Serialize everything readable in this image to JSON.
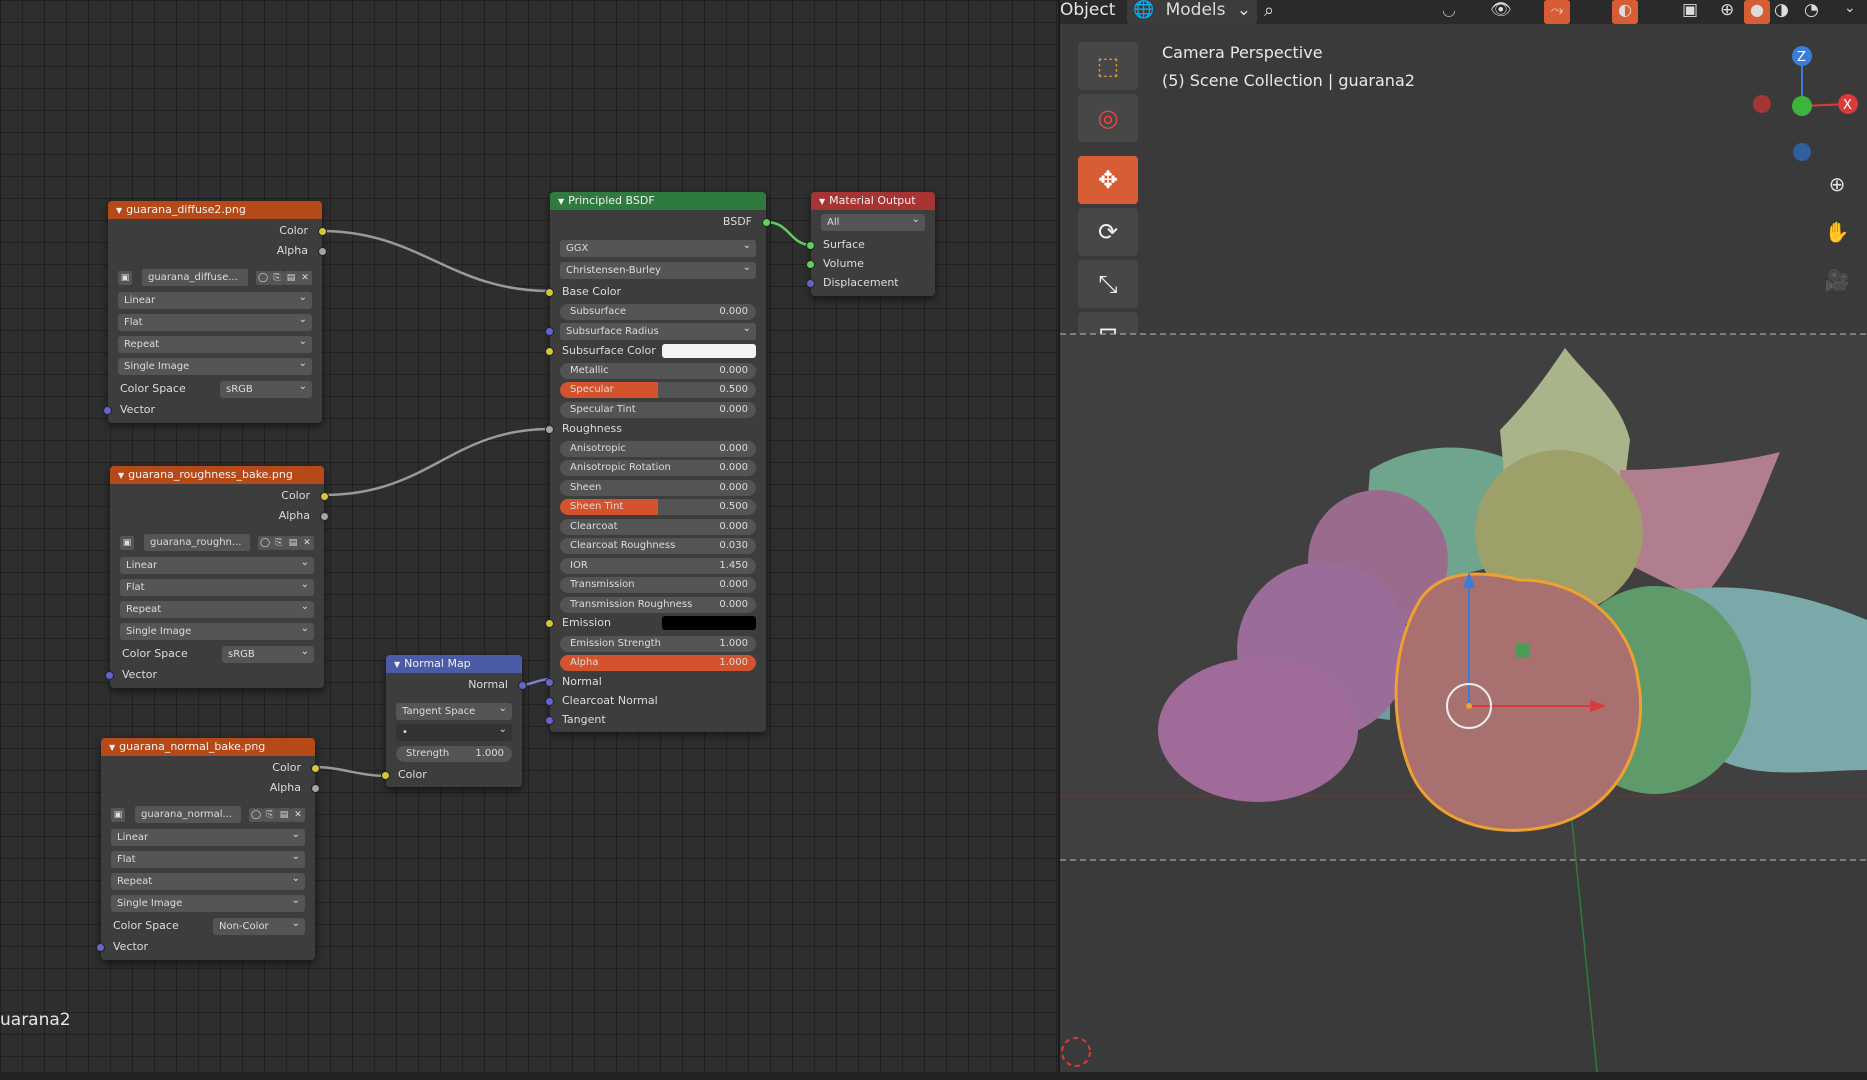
{
  "colors": {
    "accent": "#d65d34",
    "texture_header": "#b54a18",
    "shader_header": "#2f7a3d",
    "output_header": "#a73333",
    "vector_header": "#4c5ba8",
    "selection_outline": "#f0a030"
  },
  "node_editor": {
    "material_name": "uarana2",
    "nodes": {
      "tex1": {
        "title": "guarana_diffuse2.png",
        "out_color": "Color",
        "out_alpha": "Alpha",
        "image_name": "guarana_diffuse...",
        "interpolation": "Linear",
        "projection": "Flat",
        "extension": "Repeat",
        "source": "Single Image",
        "colorspace_label": "Color Space",
        "colorspace": "sRGB",
        "in_vector": "Vector"
      },
      "tex2": {
        "title": "guarana_roughness_bake.png",
        "out_color": "Color",
        "out_alpha": "Alpha",
        "image_name": "guarana_roughn...",
        "interpolation": "Linear",
        "projection": "Flat",
        "extension": "Repeat",
        "source": "Single Image",
        "colorspace_label": "Color Space",
        "colorspace": "sRGB",
        "in_vector": "Vector"
      },
      "tex3": {
        "title": "guarana_normal_bake.png",
        "out_color": "Color",
        "out_alpha": "Alpha",
        "image_name": "guarana_normal...",
        "interpolation": "Linear",
        "projection": "Flat",
        "extension": "Repeat",
        "source": "Single Image",
        "colorspace_label": "Color Space",
        "colorspace": "Non-Color",
        "in_vector": "Vector"
      },
      "normal_map": {
        "title": "Normal Map",
        "out_normal": "Normal",
        "space": "Tangent Space",
        "uv_map": "•",
        "strength_label": "Strength",
        "strength_value": "1.000",
        "in_color": "Color"
      },
      "bsdf": {
        "title": "Principled BSDF",
        "out_bsdf": "BSDF",
        "distribution": "GGX",
        "subsurface_method": "Christensen-Burley",
        "base_color": "Base Color",
        "subsurface": "Subsurface",
        "subsurface_val": "0.000",
        "subsurface_radius": "Subsurface Radius",
        "subsurface_color": "Subsurface Color",
        "metallic": "Metallic",
        "metallic_val": "0.000",
        "specular": "Specular",
        "specular_val": "0.500",
        "specular_fill": 0.5,
        "specular_tint": "Specular Tint",
        "specular_tint_val": "0.000",
        "roughness": "Roughness",
        "anisotropic": "Anisotropic",
        "anisotropic_val": "0.000",
        "anisotropic_rotation": "Anisotropic Rotation",
        "anisotropic_rotation_val": "0.000",
        "sheen": "Sheen",
        "sheen_val": "0.000",
        "sheen_tint": "Sheen Tint",
        "sheen_tint_val": "0.500",
        "sheen_tint_fill": 0.5,
        "clearcoat": "Clearcoat",
        "clearcoat_val": "0.000",
        "clearcoat_roughness": "Clearcoat Roughness",
        "clearcoat_roughness_val": "0.030",
        "ior": "IOR",
        "ior_val": "1.450",
        "transmission": "Transmission",
        "transmission_val": "0.000",
        "transmission_roughness": "Transmission Roughness",
        "transmission_roughness_val": "0.000",
        "emission": "Emission",
        "emission_strength": "Emission Strength",
        "emission_strength_val": "1.000",
        "alpha": "Alpha",
        "alpha_val": "1.000",
        "alpha_fill": 1.0,
        "normal": "Normal",
        "clearcoat_normal": "Clearcoat Normal",
        "tangent": "Tangent"
      },
      "output": {
        "title": "Material Output",
        "target": "All",
        "surface": "Surface",
        "volume": "Volume",
        "displacement": "Displacement"
      }
    }
  },
  "viewport": {
    "header_object": "Object",
    "header_models": "Models",
    "title": "Camera Perspective",
    "subtitle": "(5) Scene Collection | guarana2",
    "axis_z": "Z",
    "axis_x": "X"
  }
}
